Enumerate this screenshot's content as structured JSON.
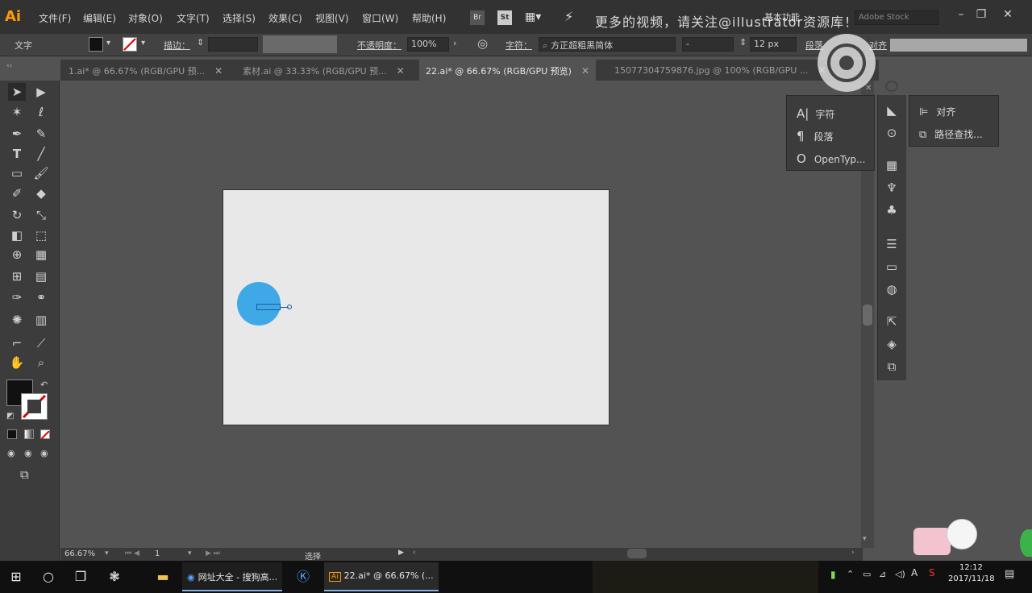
{
  "app": {
    "logo": "Ai"
  },
  "menu": [
    "文件(F)",
    "编辑(E)",
    "对象(O)",
    "文字(T)",
    "选择(S)",
    "效果(C)",
    "视图(V)",
    "窗口(W)",
    "帮助(H)"
  ],
  "menubar_icons": {
    "br": "Br",
    "st": "St"
  },
  "workspace": {
    "label": "基本功能",
    "search_placeholder": "Adobe Stock"
  },
  "watermark": "更多的视频，请关注@illustrator资源库！",
  "control_bar": {
    "selection_label": "文字",
    "stroke_label": "描边：",
    "opacity_label": "不透明度：",
    "opacity_value": "100%",
    "char_label": "字符：",
    "font_family": "方正超粗黑简体",
    "font_style": "-",
    "font_size": "12 px",
    "para_label": "段落",
    "align_label": "对齐"
  },
  "tabs": [
    {
      "label": "1.ai* @ 66.67% (RGB/GPU 预...",
      "active": false
    },
    {
      "label": "素材.ai @ 33.33% (RGB/GPU 预...",
      "active": false
    },
    {
      "label": "22.ai* @ 66.67% (RGB/GPU 预览)",
      "active": true
    },
    {
      "label": "15077304759876.jpg @ 100% (RGB/GPU ...",
      "active": false
    }
  ],
  "char_panel": {
    "items": [
      "字符",
      "段落",
      "OpenTyp..."
    ]
  },
  "align_panel": {
    "items": [
      "对齐",
      "路径查找..."
    ]
  },
  "status_bar": {
    "zoom": "66.67%",
    "artboard": "1",
    "tool": "选择"
  },
  "taskbar": {
    "apps": [
      {
        "label": "网址大全 - 搜狗高..."
      },
      {
        "label": "22.ai* @ 66.67% (..."
      }
    ],
    "time": "12:12",
    "date": "2017/11/18",
    "ime": "A"
  },
  "colors": {
    "fill_swatch": "#111111",
    "circle": "#3fa9e8",
    "artboard": "#e8e8e8",
    "accent": "#ff9a00"
  }
}
